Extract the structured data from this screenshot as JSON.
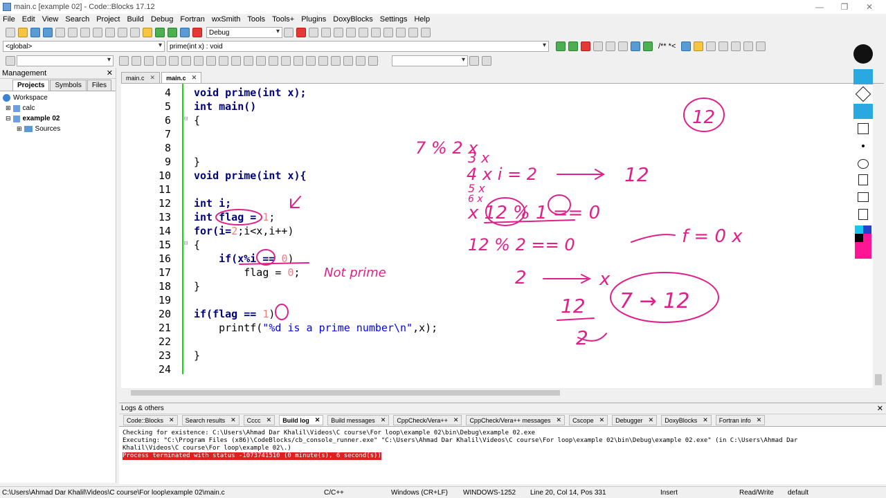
{
  "window": {
    "title": "main.c [example 02] - Code::Blocks 17.12",
    "minimize": "—",
    "maximize": "❐",
    "close": "✕"
  },
  "menu": [
    "File",
    "Edit",
    "View",
    "Search",
    "Project",
    "Build",
    "Debug",
    "Fortran",
    "wxSmith",
    "Tools",
    "Tools+",
    "Plugins",
    "DoxyBlocks",
    "Settings",
    "Help"
  ],
  "toolbar": {
    "build_target": "Debug",
    "scope": "<global>",
    "function": "prime(int x) : void",
    "search_text": "",
    "doc_comment": "/** *<"
  },
  "management": {
    "title": "Management",
    "close": "✕",
    "tabs": [
      "Projects",
      "Symbols",
      "Files"
    ],
    "active_tab": "Projects",
    "tree": [
      {
        "label": "Workspace",
        "level": 0
      },
      {
        "label": "calc",
        "level": 1
      },
      {
        "label": "example 02",
        "level": 1,
        "bold": true
      },
      {
        "label": "Sources",
        "level": 2
      }
    ]
  },
  "editor_tabs": [
    {
      "label": "main.c",
      "active": false
    },
    {
      "label": "main.c",
      "active": true
    }
  ],
  "code": {
    "line_numbers": [
      "4",
      "5",
      "6",
      "7",
      "8",
      "9",
      "10",
      "11",
      "12",
      "13",
      "14",
      "15",
      "16",
      "17",
      "18",
      "19",
      "20",
      "21",
      "22",
      "23",
      "24"
    ],
    "lines": {
      "l4": "void prime(int x);",
      "l5": "int main()",
      "l6": "{",
      "l9": "}",
      "l10": "void prime(int x){",
      "l12": "int i;",
      "l13_a": "int flag = ",
      "l13_n": "1",
      "l13_b": ";",
      "l14_a": "for(i=",
      "l14_n": "2",
      "l14_b": ";i<x,i++)",
      "l15": "{",
      "l16_a": "    if(x%i == ",
      "l16_n": "0",
      "l16_b": ")",
      "l17_a": "        flag = ",
      "l17_n": "0",
      "l17_b": ";",
      "l18": "}",
      "l20_a": "if(flag == ",
      "l20_n": "1",
      "l20_b": ")",
      "l21_a": "    printf(",
      "l21_s": "\"%d is a prime number\\n\"",
      "l21_b": ",x);",
      "l23": "}"
    }
  },
  "annotations": {
    "not_prime": "Not prime",
    "top_right": "12",
    "mod_line1": "7 % 2 x",
    "mod_line2": "3 x",
    "mod_line3": "4 x i = 2",
    "arrow_target1": "12",
    "mod_line4": "5 x",
    "mod_line5": "6 x",
    "mod_line6": "x 12 % 1 == 0",
    "mod_line7": "12 % 2 == 0",
    "flag_note": "f = 0 x",
    "two_arrow": "2",
    "two_x": "x",
    "frac_top": "12",
    "frac_bottom": "2",
    "loop_range": "7 → 12"
  },
  "logs": {
    "title": "Logs & others",
    "close": "✕",
    "tabs": [
      "Code::Blocks",
      "Search results",
      "Cccc",
      "Build log",
      "Build messages",
      "CppCheck/Vera++",
      "CppCheck/Vera++ messages",
      "Cscope",
      "Debugger",
      "DoxyBlocks",
      "Fortran info"
    ],
    "active_tab": "Build log",
    "text": [
      "Checking for existence: C:\\Users\\Ahmad Dar Khalil\\Videos\\C course\\For loop\\example 02\\bin\\Debug\\example 02.exe",
      "Executing: \"C:\\Program Files (x86)\\CodeBlocks/cb_console_runner.exe\" \"C:\\Users\\Ahmad Dar Khalil\\Videos\\C course\\For loop\\example 02\\bin\\Debug\\example 02.exe\"  (in C:\\Users\\Ahmad Dar",
      "Khalil\\Videos\\C course\\For loop\\example 02\\.)"
    ],
    "error": "Process terminated with status -1073741510 (0 minute(s), 6 second(s))"
  },
  "status": {
    "path": "C:\\Users\\Ahmad Dar Khalil\\Videos\\C course\\For loop\\example 02\\main.c",
    "lang": "C/C++",
    "eol": "Windows (CR+LF)",
    "encoding": "WINDOWS-1252",
    "position": "Line 20, Col 14, Pos 331",
    "mode": "Insert",
    "rw": "Read/Write",
    "profile": "default"
  },
  "colors": {
    "ink": "#e0208a",
    "fold_bar": "#19d419",
    "error_bg": "#e02020"
  }
}
